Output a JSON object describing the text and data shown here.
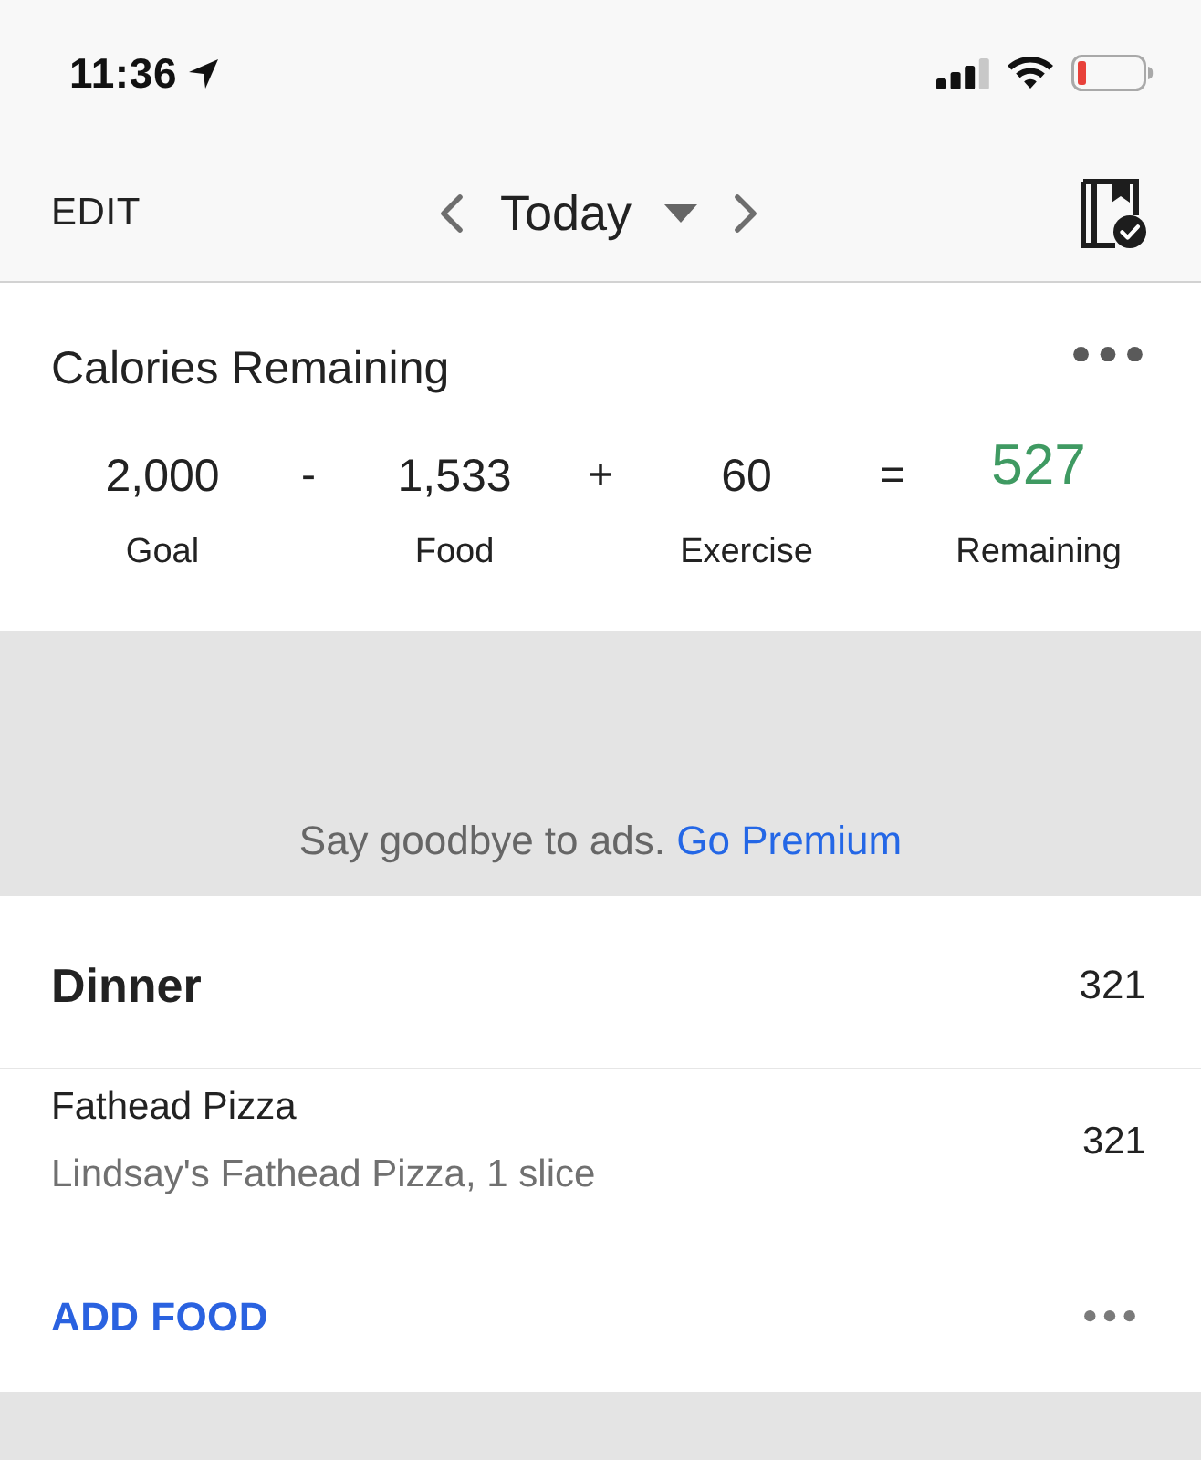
{
  "status_bar": {
    "time": "11:36"
  },
  "nav": {
    "edit": "EDIT",
    "date": "Today"
  },
  "calories": {
    "title": "Calories Remaining",
    "equation": [
      {
        "kind": "term",
        "value": "2,000",
        "label": "Goal"
      },
      {
        "kind": "operator",
        "symbol": "-"
      },
      {
        "kind": "term",
        "value": "1,533",
        "label": "Food"
      },
      {
        "kind": "operator",
        "symbol": "+"
      },
      {
        "kind": "term",
        "value": "60",
        "label": "Exercise"
      },
      {
        "kind": "operator",
        "symbol": "="
      },
      {
        "kind": "result",
        "value": "527",
        "label": "Remaining"
      }
    ]
  },
  "ad": {
    "text": "Say goodbye to ads.",
    "link": "Go Premium"
  },
  "meals": [
    {
      "name": "Dinner",
      "calories": "321",
      "foods": [
        {
          "name": "Fathead Pizza",
          "description": "Lindsay's Fathead Pizza, 1 slice",
          "calories": "321"
        }
      ],
      "action": "ADD FOOD"
    }
  ]
}
